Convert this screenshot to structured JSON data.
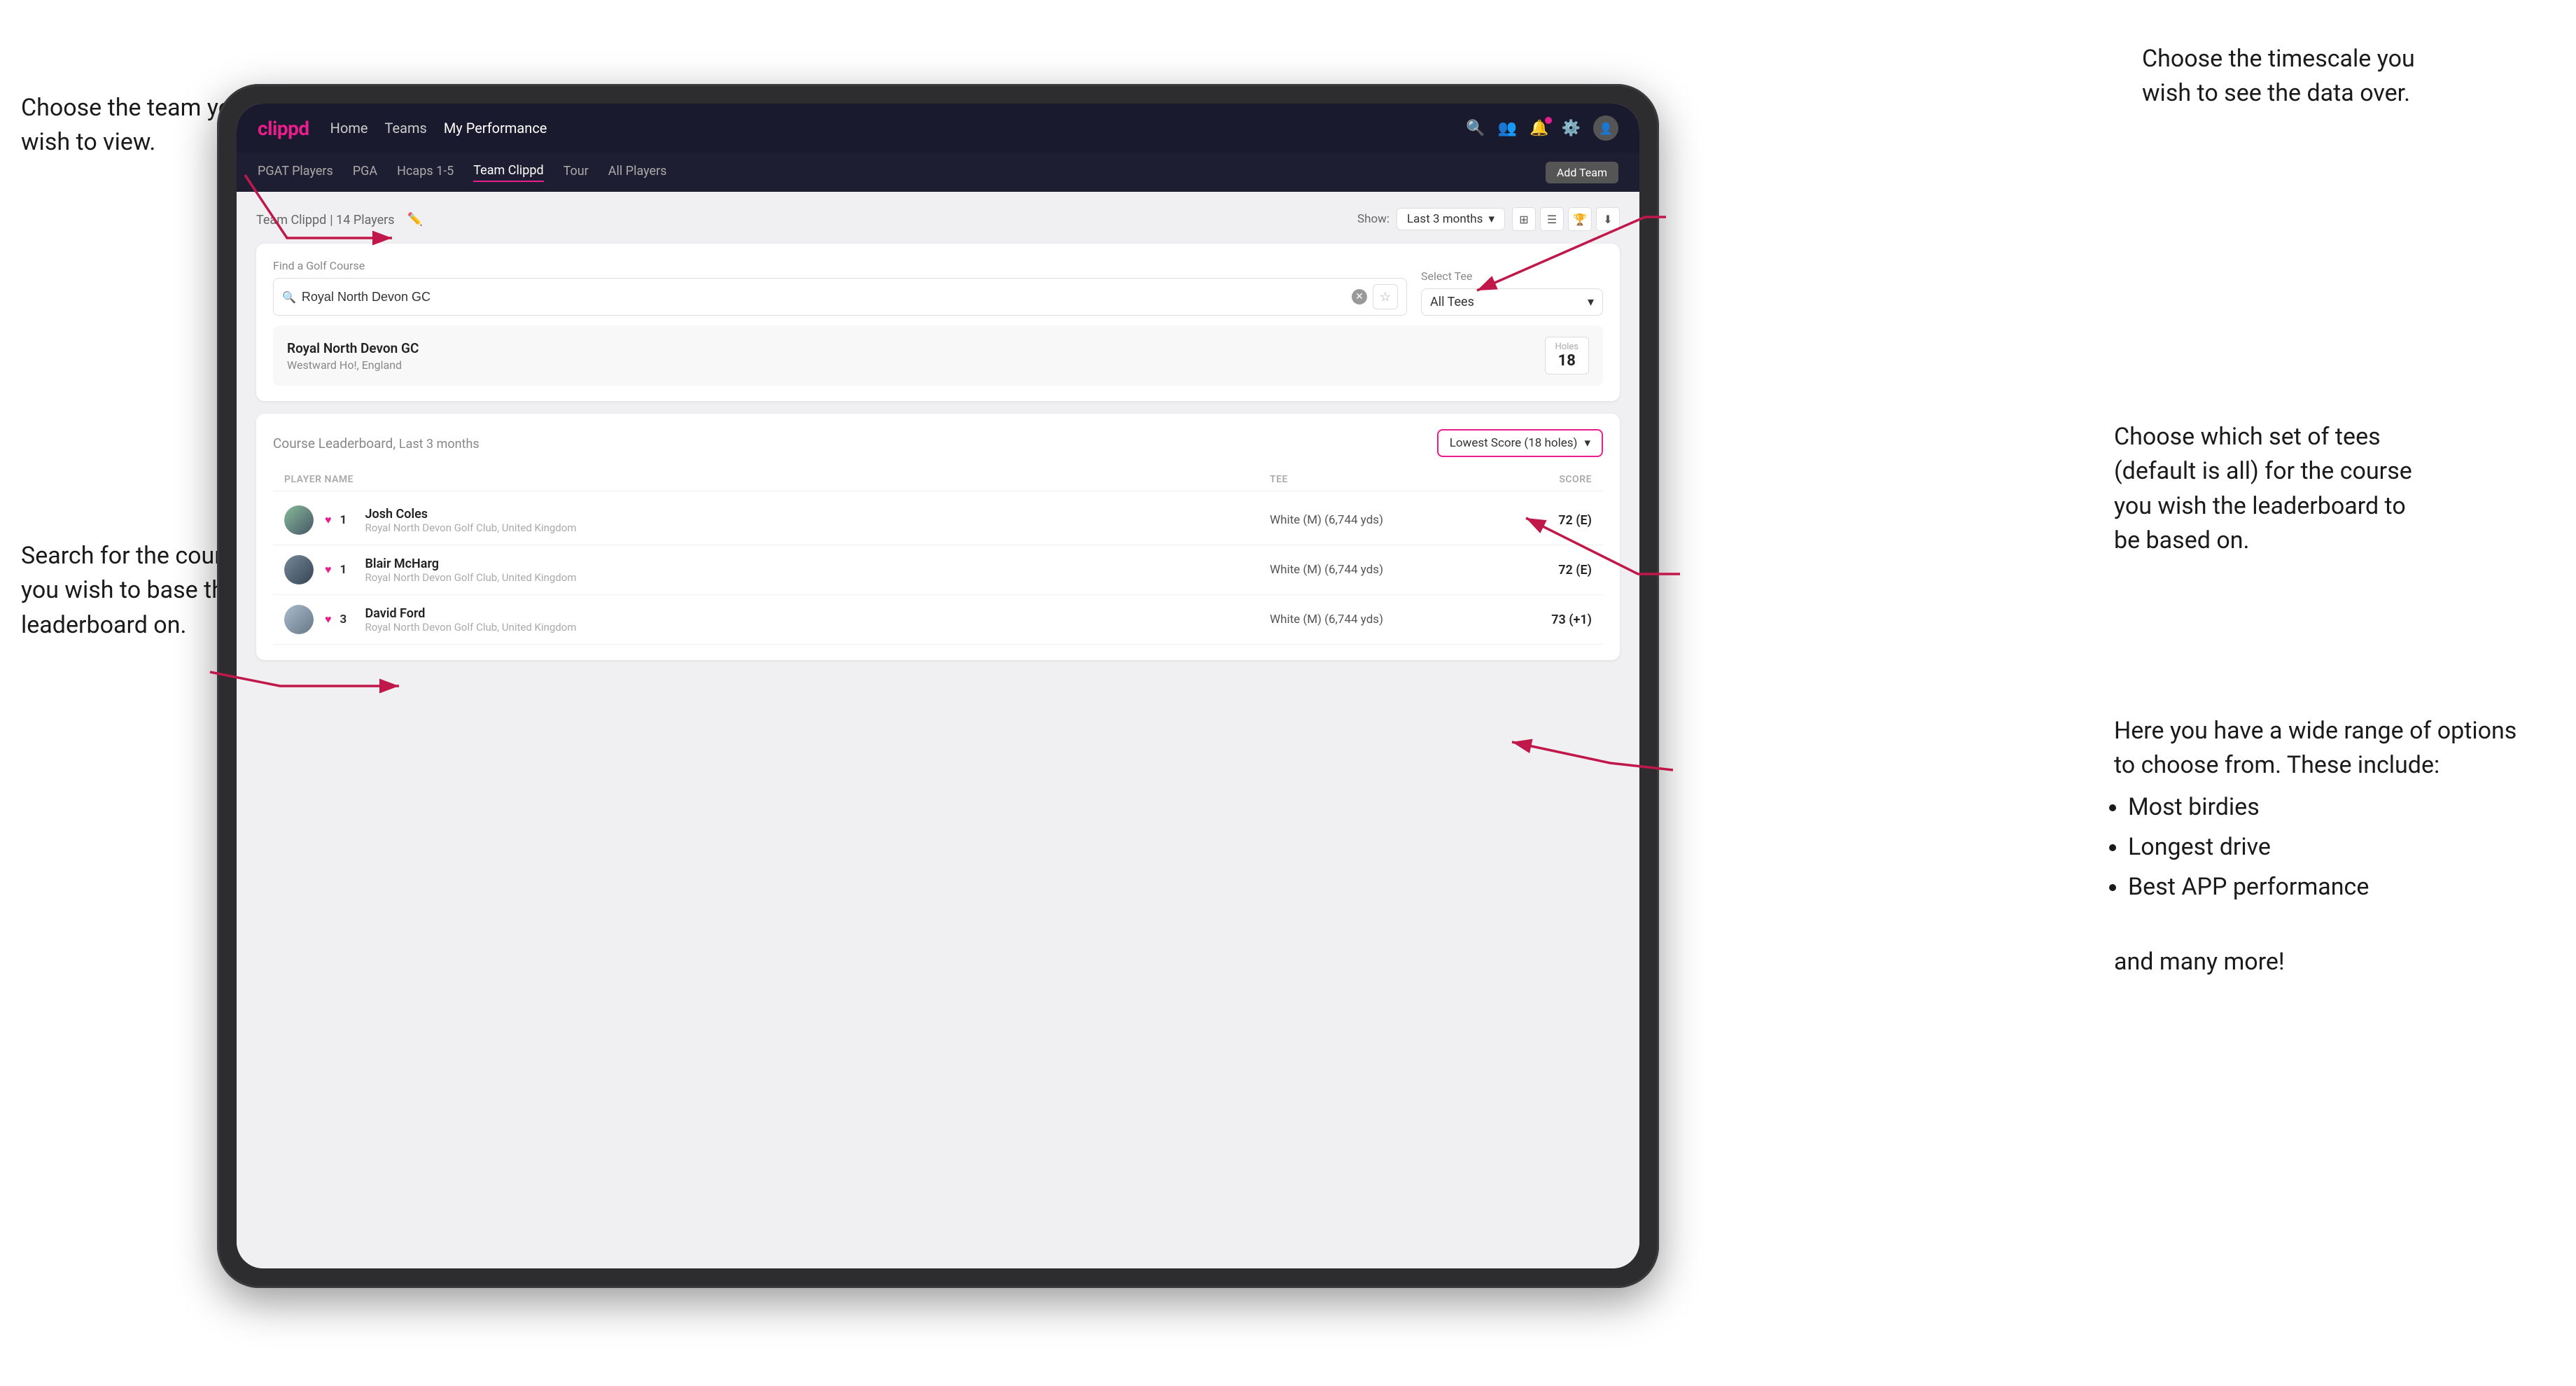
{
  "annotations": {
    "top_left": {
      "line1": "Choose the team you",
      "line2": "wish to view."
    },
    "bottom_left": {
      "line1": "Search for the course",
      "line2": "you wish to base the",
      "line3": "leaderboard on."
    },
    "top_right": {
      "line1": "Choose the timescale you",
      "line2": "wish to see the data over."
    },
    "mid_right": {
      "line1": "Choose which set of tees",
      "line2": "(default is all) for the course",
      "line3": "you wish the leaderboard to",
      "line4": "be based on."
    },
    "bottom_right": {
      "intro": "Here you have a wide range of options to choose from. These include:",
      "bullets": [
        "Most birdies",
        "Longest drive",
        "Best APP performance"
      ],
      "outro": "and many more!"
    }
  },
  "nav": {
    "logo": "clippd",
    "links": [
      "Home",
      "Teams",
      "My Performance"
    ],
    "active_link": "My Performance"
  },
  "tabs": {
    "items": [
      "PGAT Players",
      "PGA",
      "Hcaps 1-5",
      "Team Clippd",
      "Tour",
      "All Players"
    ],
    "active": "Team Clippd",
    "add_button": "Add Team"
  },
  "team_header": {
    "title": "Team Clippd",
    "player_count": "14 Players",
    "show_label": "Show:",
    "time_period": "Last 3 months"
  },
  "search": {
    "find_label": "Find a Golf Course",
    "placeholder": "Royal North Devon GC",
    "tee_label": "Select Tee",
    "tee_value": "All Tees"
  },
  "course": {
    "name": "Royal North Devon GC",
    "location": "Westward Ho!, England",
    "holes_label": "Holes",
    "holes_value": "18"
  },
  "leaderboard": {
    "title": "Course Leaderboard,",
    "period": "Last 3 months",
    "score_option": "Lowest Score (18 holes)",
    "col_player": "PLAYER NAME",
    "col_tee": "TEE",
    "col_score": "SCORE",
    "players": [
      {
        "rank": "1",
        "name": "Josh Coles",
        "club": "Royal North Devon Golf Club, United Kingdom",
        "tee": "White (M) (6,744 yds)",
        "score": "72 (E)"
      },
      {
        "rank": "1",
        "name": "Blair McHarg",
        "club": "Royal North Devon Golf Club, United Kingdom",
        "tee": "White (M) (6,744 yds)",
        "score": "72 (E)"
      },
      {
        "rank": "3",
        "name": "David Ford",
        "club": "Royal North Devon Golf Club, United Kingdom",
        "tee": "White (M) (6,744 yds)",
        "score": "73 (+1)"
      }
    ]
  },
  "colors": {
    "brand_pink": "#e91e8c",
    "nav_bg": "#1a1a2e",
    "tab_bg": "#1e1e32"
  }
}
